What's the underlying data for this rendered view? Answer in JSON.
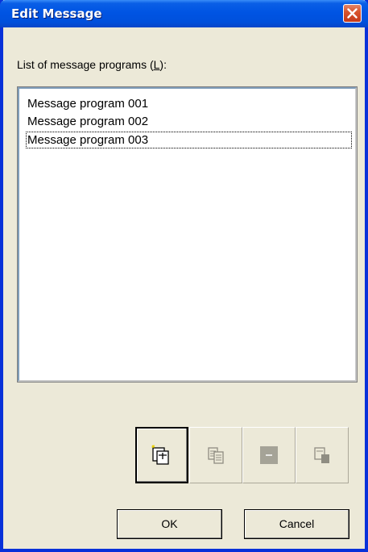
{
  "window": {
    "title": "Edit Message"
  },
  "list": {
    "label_prefix": "List of message programs (",
    "label_accel": "L",
    "label_suffix": "):",
    "items": [
      "Message program 001",
      "Message program 002",
      "Message program 003"
    ],
    "focused_index": 2
  },
  "toolbar": {
    "buttons": [
      {
        "icon": "new-item-icon",
        "enabled": true
      },
      {
        "icon": "copy-icon",
        "enabled": false
      },
      {
        "icon": "delete-icon",
        "enabled": false
      },
      {
        "icon": "move-icon",
        "enabled": false
      }
    ]
  },
  "buttons": {
    "ok": "OK",
    "cancel": "Cancel"
  },
  "colors": {
    "titlebar": "#0054e3",
    "close": "#d9552e",
    "face": "#ece9d8"
  }
}
